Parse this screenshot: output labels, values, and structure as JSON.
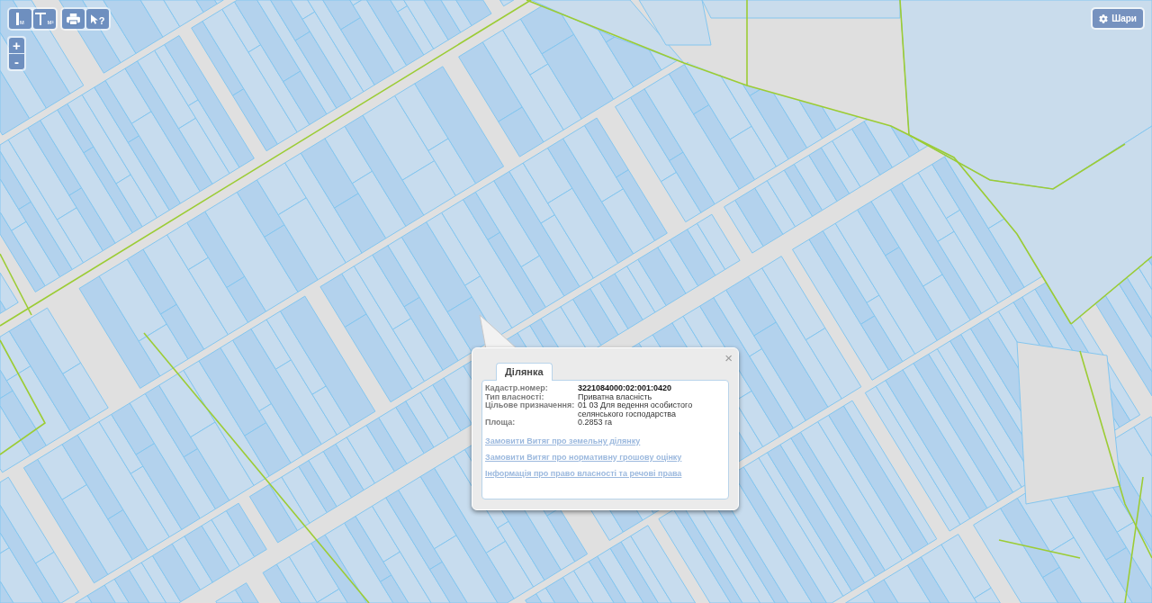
{
  "toolbar": {
    "groups": [
      {
        "buttons": [
          {
            "kind": "length",
            "label": "м"
          },
          {
            "kind": "area",
            "label": "м²"
          }
        ]
      },
      {
        "buttons": [
          {
            "kind": "print"
          },
          {
            "kind": "identify",
            "label": "?"
          }
        ]
      }
    ]
  },
  "zoom_controls": [
    {
      "kind": "in",
      "label": "+"
    },
    {
      "kind": "out",
      "label": "-"
    }
  ],
  "layers_button": {
    "label": "Шари"
  },
  "popup": {
    "close": "×",
    "tabs": [
      {
        "label": "Ділянка",
        "selected": true
      }
    ],
    "fields": [
      {
        "label": "Кадастр.номер:",
        "value": "3221084000:02:001:0420",
        "emphasis": true
      },
      {
        "label": "Тип власності:",
        "value": "Приватна власність",
        "emphasis": false
      },
      {
        "label": "Цільове призначення:",
        "value": "01 03 Для ведення особистого селянського господарства",
        "emphasis": false
      },
      {
        "label": "Площа:",
        "value": "0.2853 га",
        "emphasis": false
      }
    ],
    "links": [
      "Замовити Витяг про земельну ділянку",
      "Замовити Витяг про нормативну грошову оцінку",
      "Інформація про право власності та речові права"
    ]
  }
}
